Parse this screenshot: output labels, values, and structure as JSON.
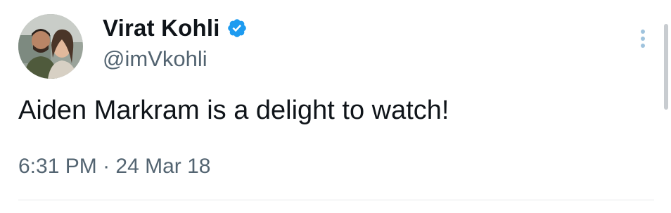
{
  "author": {
    "display_name": "Virat Kohli",
    "handle": "@imVkohli",
    "verified": true,
    "avatar_icon": "profile-photo"
  },
  "tweet": {
    "text": "Aiden Markram is a delight to watch!",
    "time": "6:31 PM",
    "separator": "·",
    "date": "24 Mar 18"
  },
  "icons": {
    "verified": "verified-badge-icon",
    "more": "more-options-icon"
  },
  "colors": {
    "text_primary": "#0f1419",
    "text_secondary": "#536471",
    "verified_blue": "#1d9bf0",
    "more_icon": "#9fc3dd"
  }
}
